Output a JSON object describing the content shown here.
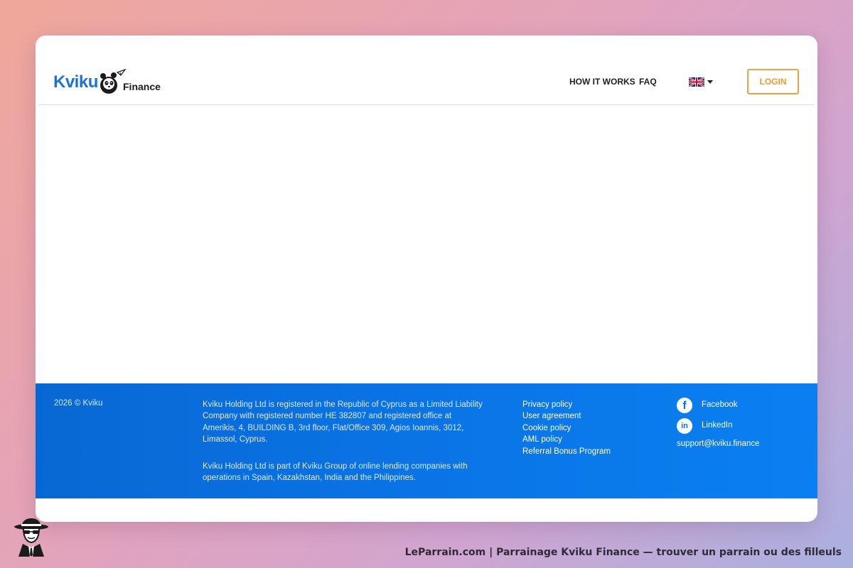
{
  "header": {
    "logo": {
      "brand": "Kviku",
      "product": "Finance"
    },
    "nav": [
      {
        "label": "HOW IT WORKS"
      },
      {
        "label": "FAQ"
      }
    ],
    "language": {
      "icon": "uk-flag-icon"
    },
    "login_label": "LOGIN"
  },
  "footer": {
    "copyright": "2026 © Kviku",
    "legal": [
      "Kviku Holding Ltd is registered in the Republic of Cyprus as a Limited Liability Company with registered number HE 382807 and registered office at Amerikis, 4, BUILDING B, 3rd floor, Flat/Office 309, Agios Ioannis, 3012, Limassol, Cyprus.",
      "Kviku Holding Ltd is part of Kviku Group of online lending companies with operations in Spain, Kazakhstan, India and the Philippines."
    ],
    "links": [
      {
        "label": "Privacy policy"
      },
      {
        "label": "User agreement"
      },
      {
        "label": "Cookie policy"
      },
      {
        "label": "AML policy"
      },
      {
        "label": "Referral Bonus Program"
      }
    ],
    "social": [
      {
        "label": "Facebook",
        "icon": "facebook-icon",
        "glyph": "f"
      },
      {
        "label": "LinkedIn",
        "icon": "linkedin-icon",
        "glyph": "in"
      }
    ],
    "support_email": "support@kviku.finance"
  },
  "watermark": {
    "text": "LeParrain.com | Parrainage Kviku Finance — trouver un parrain ou des filleuls"
  },
  "colors": {
    "brand_blue": "#1a73d9",
    "footer_blue": "#0a74e6",
    "login_orange": "#f09a33"
  }
}
